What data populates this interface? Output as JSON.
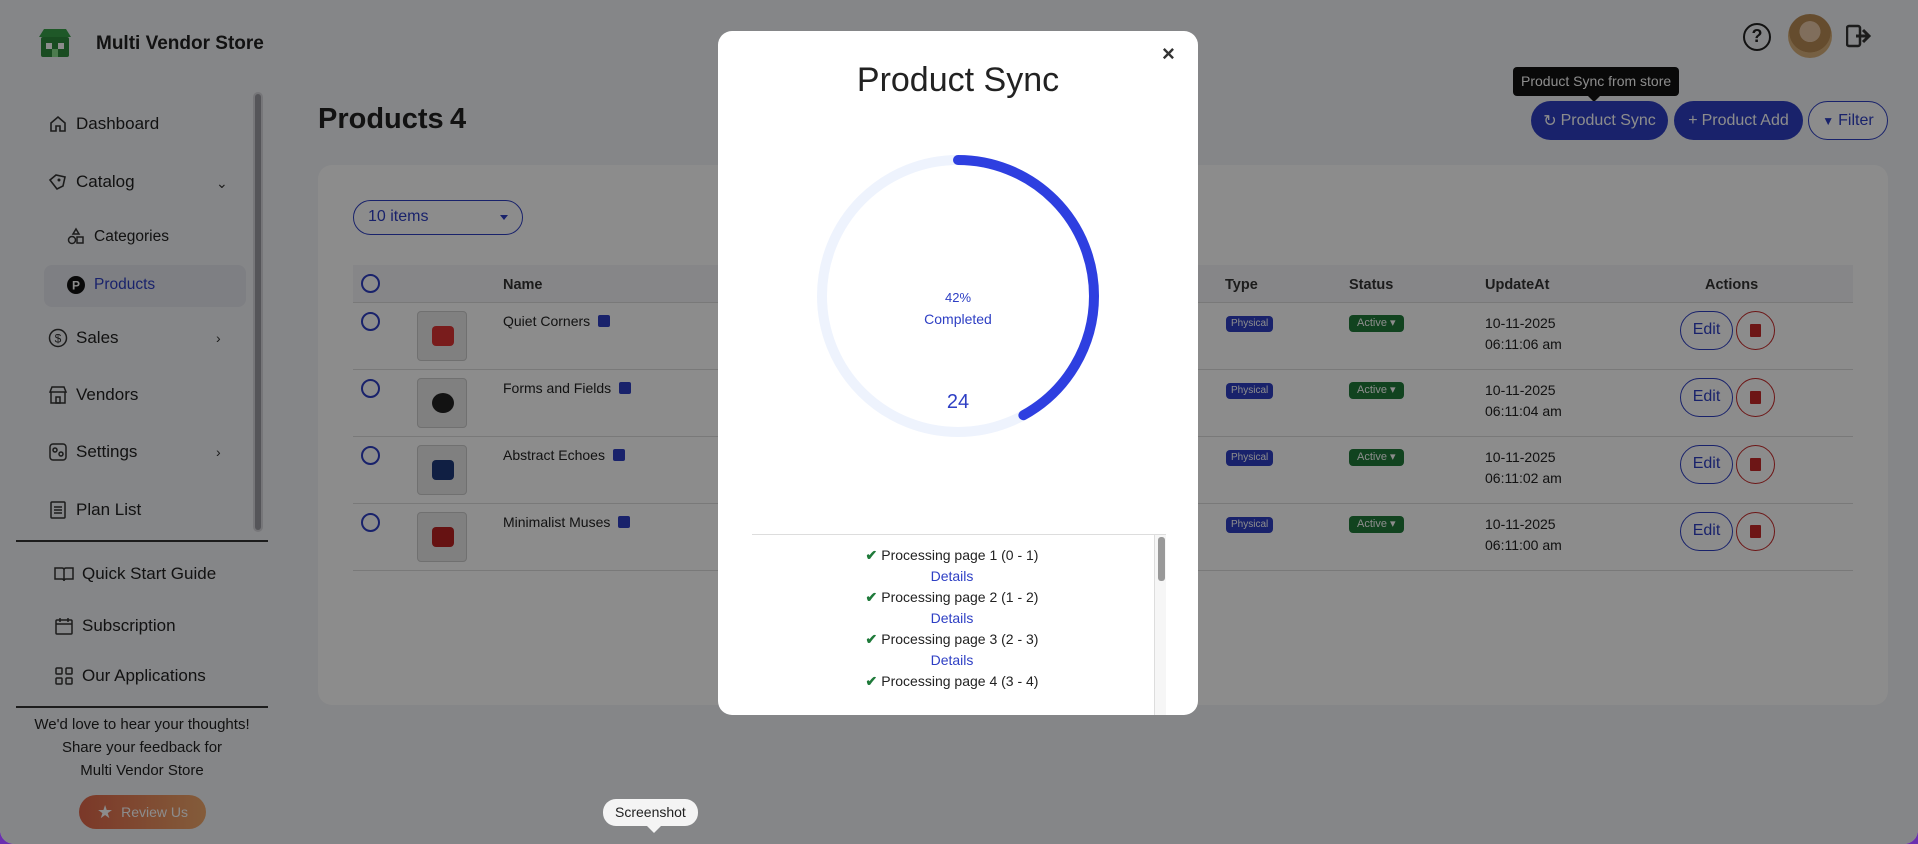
{
  "app": {
    "brand": "Multi Vendor Store"
  },
  "header": {
    "help_icon": "question-circle-icon",
    "avatar": "user-avatar",
    "logout_icon": "logout-icon"
  },
  "sidebar": {
    "items": [
      {
        "label": "Dashboard",
        "icon": "home-icon"
      },
      {
        "label": "Catalog",
        "icon": "tag-icon"
      },
      {
        "label": "Categories",
        "icon": "shapes-icon"
      },
      {
        "label": "Products",
        "icon": "product-p-icon"
      },
      {
        "label": "Sales",
        "icon": "dollar-icon"
      },
      {
        "label": "Vendors",
        "icon": "store-icon"
      },
      {
        "label": "Settings",
        "icon": "settings-icon"
      },
      {
        "label": "Plan List",
        "icon": "list-icon"
      }
    ],
    "links": [
      {
        "label": "Quick Start Guide",
        "icon": "book-icon"
      },
      {
        "label": "Subscription",
        "icon": "calendar-icon"
      },
      {
        "label": "Our Applications",
        "icon": "apps-icon"
      }
    ],
    "feedback": [
      "We'd love to hear your thoughts!",
      "Share your feedback for",
      "Multi Vendor Store"
    ],
    "review_label": "Review Us"
  },
  "page": {
    "title": "Products",
    "count": "4",
    "buttons": {
      "sync": "Product Sync",
      "add": "Product Add",
      "filter": "Filter"
    },
    "tooltip": "Product Sync from store",
    "per_page": "10 items"
  },
  "table": {
    "columns": [
      "Name",
      "Type",
      "Status",
      "UpdateAt",
      "Actions"
    ],
    "rows": [
      {
        "name": "Quiet Corners",
        "type": "Physical",
        "status": "Active",
        "date": "10-11-2025",
        "time": "06:11:06 am",
        "thumb_color": "#d33"
      },
      {
        "name": "Forms and Fields",
        "type": "Physical",
        "status": "Active",
        "date": "10-11-2025",
        "time": "06:11:04 am",
        "thumb_color": "#222"
      },
      {
        "name": "Abstract Echoes",
        "type": "Physical",
        "status": "Active",
        "date": "10-11-2025",
        "time": "06:11:02 am",
        "thumb_color": "#1e3a7a"
      },
      {
        "name": "Minimalist Muses",
        "type": "Physical",
        "status": "Active",
        "date": "10-11-2025",
        "time": "06:11:00 am",
        "thumb_color": "#b22"
      }
    ],
    "edit_label": "Edit"
  },
  "modal": {
    "title": "Product Sync",
    "close": "×",
    "progress_percent": 42,
    "percent_label": "42%",
    "completed_label": "Completed",
    "count": "24",
    "log": [
      {
        "text": "Processing page 1 (0 - 1)",
        "link": "Details"
      },
      {
        "text": "Processing page 2 (1 - 2)",
        "link": "Details"
      },
      {
        "text": "Processing page 3 (2 - 3)",
        "link": "Details"
      },
      {
        "text": "Processing page 4 (3 - 4)",
        "link": ""
      }
    ]
  },
  "screenshot_tip": "Screenshot",
  "colors": {
    "accent": "#2e3fc4",
    "success": "#1f7a3a",
    "danger": "#c62828"
  }
}
